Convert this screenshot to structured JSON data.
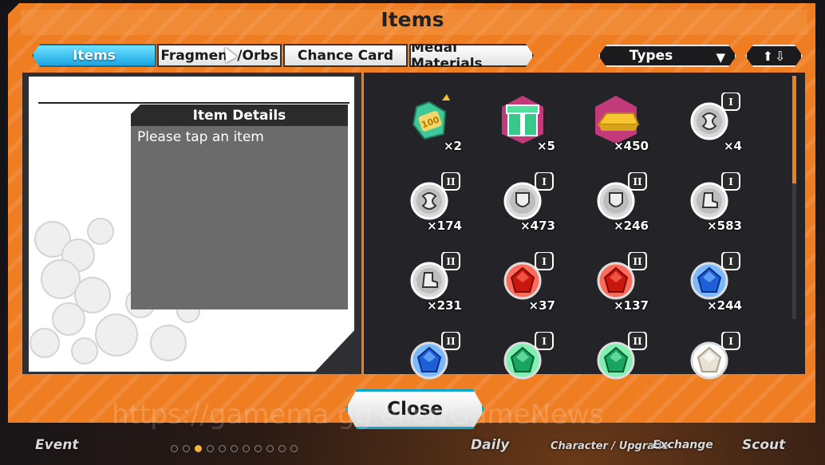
{
  "window": {
    "title": "Items"
  },
  "tabs": [
    {
      "label": "Items",
      "active": true
    },
    {
      "label": "Fragmen",
      "label_tail": "/Orbs",
      "active": false
    },
    {
      "label": "Chance Card",
      "active": false
    },
    {
      "label": "Medal Materials",
      "active": false
    }
  ],
  "filter": {
    "selected": "Types",
    "arrow": "▼"
  },
  "sort": {
    "up": "⬆",
    "down": "⇩"
  },
  "details": {
    "header": "Item Details",
    "body": "Please tap an item"
  },
  "items": [
    {
      "icon": "capsule-voucher-icon",
      "count": "×2"
    },
    {
      "icon": "gift-box-icon",
      "count": "×5"
    },
    {
      "icon": "gold-bar-icon",
      "count": "×450"
    },
    {
      "icon": "silver-medal-1-icon",
      "count": "×4",
      "rank": "I"
    },
    {
      "icon": "silver-medal-2-icon",
      "count": "×174",
      "rank": "II"
    },
    {
      "icon": "shield-medal-icon",
      "count": "×473",
      "rank": "I"
    },
    {
      "icon": "shield-medal-2-icon",
      "count": "×246",
      "rank": "II"
    },
    {
      "icon": "boot-medal-icon",
      "count": "×583",
      "rank": "I"
    },
    {
      "icon": "boot-medal-2-icon",
      "count": "×231",
      "rank": "II"
    },
    {
      "icon": "red-orb-icon",
      "count": "×37",
      "rank": "I"
    },
    {
      "icon": "red-orb-2-icon",
      "count": "×137",
      "rank": "II"
    },
    {
      "icon": "blue-orb-icon",
      "count": "×244",
      "rank": "I"
    },
    {
      "icon": "blue-orb-2-icon",
      "count": "",
      "rank": "II"
    },
    {
      "icon": "green-orb-icon",
      "count": "",
      "rank": "I"
    },
    {
      "icon": "green-orb-2-icon",
      "count": "",
      "rank": "II"
    },
    {
      "icon": "white-orb-icon",
      "count": "",
      "rank": "I"
    }
  ],
  "close_button": "Close",
  "watermark": "https://gamema   gg   eller/GameNews",
  "bottom_nav": [
    "Event",
    "Daily",
    "Character / Upgrade",
    "Exchange",
    "Scout"
  ],
  "colors": {
    "frame": "#ef7d22",
    "tab_active": "#1aa7e3",
    "close_border": "#0ca7cf"
  }
}
